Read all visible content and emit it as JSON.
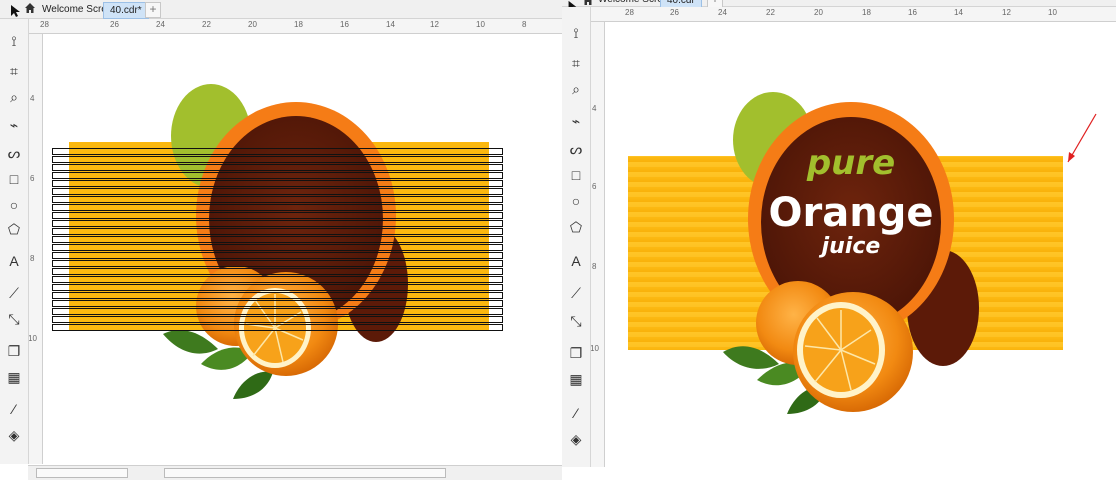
{
  "tabs": {
    "welcome": "Welcome Screen",
    "left_doc": "40.cdr*",
    "right_doc": "40.cdr"
  },
  "ruler_labels": {
    "left_h": [
      "28",
      "26",
      "24",
      "22",
      "20",
      "18",
      "16",
      "14",
      "12",
      "10",
      "8"
    ],
    "right_h": [
      "28",
      "26",
      "24",
      "22",
      "20",
      "18",
      "16",
      "14",
      "12",
      "10"
    ],
    "left_v": [
      "4",
      "6",
      "8",
      "10"
    ],
    "right_v": [
      "4",
      "6",
      "8",
      "10"
    ]
  },
  "label": {
    "line1": "pure",
    "line2": "Orange",
    "line3": "juice"
  },
  "colors": {
    "yellow_band": "#fbb80f",
    "ring_orange": "#f57c16",
    "dark_brown": "#5c1a08",
    "green_leafy": "#a2bf2d",
    "white": "#ffffff",
    "arrow_red": "#e02020"
  },
  "tools": [
    "pick-tool-icon",
    "shape-tool-icon",
    "crop-tool-icon",
    "zoom-tool-icon",
    "freehand-tool-icon",
    "artistic-media-icon",
    "rectangle-tool-icon",
    "ellipse-tool-icon",
    "polygon-tool-icon",
    "text-tool-icon",
    "parallel-dimension-icon",
    "connector-tool-icon",
    "drop-shadow-icon",
    "transparency-icon",
    "eyedropper-icon",
    "interactive-fill-icon"
  ]
}
